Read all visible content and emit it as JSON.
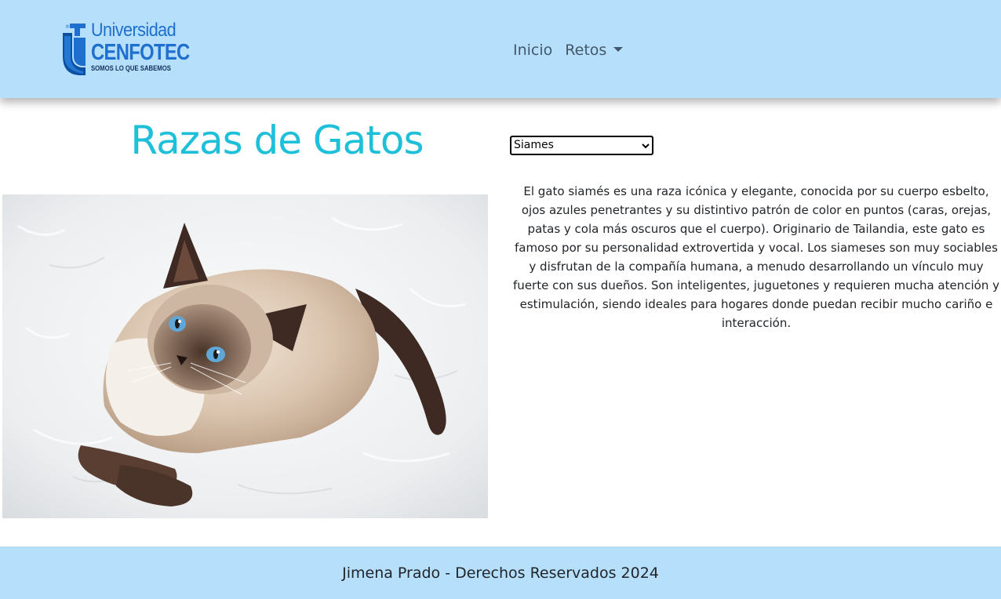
{
  "header": {
    "logo": {
      "line1": "Universidad",
      "line2": "CENFOTEC",
      "line3": "SOMOS LO QUE SABEMOS",
      "icon": "cenfotec-logo-icon",
      "brand_color": "#1e6fce"
    },
    "nav": {
      "home_label": "Inicio",
      "challenges_label": "Retos",
      "challenges_icon": "caret-down-icon"
    },
    "background_color": "#b6dffb"
  },
  "main": {
    "title": "Razas de Gatos",
    "title_color": "#1ebfd9",
    "breed_select": {
      "selected": "Siames",
      "icon": "chevron-down-icon"
    },
    "photo": {
      "icon": "siamese-cat-photo"
    },
    "description": "El gato siamés es una raza icónica y elegante, conocida por su cuerpo esbelto, ojos azules penetrantes y su distintivo patrón de color en puntos (caras, orejas, patas y cola más oscuros que el cuerpo). Originario de Tailandia, este gato es famoso por su personalidad extrovertida y vocal. Los siameses son muy sociables y disfrutan de la compañía humana, a menudo desarrollando un vínculo muy fuerte con sus dueños. Son inteligentes, juguetones y requieren mucha atención y estimulación, siendo ideales para hogares donde puedan recibir mucho cariño e interacción."
  },
  "footer": {
    "text": "Jimena Prado - Derechos Reservados 2024"
  }
}
